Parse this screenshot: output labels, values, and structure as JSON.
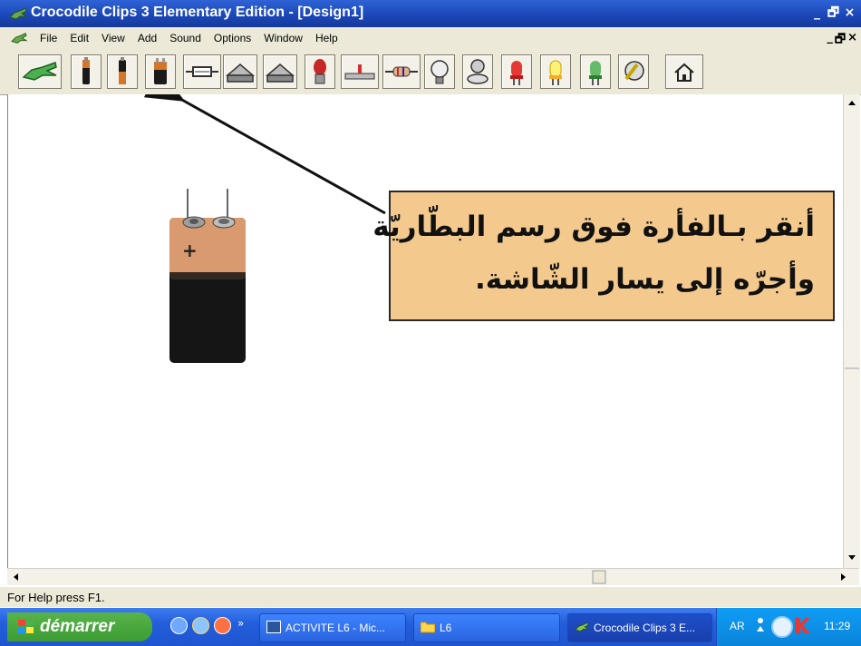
{
  "titlebar": {
    "title": "Crocodile Clips 3 Elementary Edition - [Design1]",
    "buttons": [
      "_",
      "🗗",
      "×"
    ]
  },
  "menubar": {
    "items": [
      "File",
      "Edit",
      "View",
      "Add",
      "Sound",
      "Options",
      "Window",
      "Help"
    ],
    "mdi_buttons": [
      "_",
      "🗗",
      "×"
    ]
  },
  "toolbar": {
    "tools": [
      "crocodile-icon",
      "cell-battery-icon",
      "cell-battery-icon",
      "9v-battery-icon",
      "fuse-icon",
      "switch-icon",
      "switch-icon",
      "bulb-icon",
      "push-switch-icon",
      "resistor-icon",
      "lamp-icon",
      "buzzer-icon",
      "red-led-icon",
      "yellow-led-icon",
      "green-led-icon",
      "motor-icon",
      "home-icon"
    ]
  },
  "canvas": {
    "component": "9v-battery",
    "battery_sign": "+"
  },
  "callout": {
    "line1": "أنقر بـالفأرة فوق رسم البطّاريّة",
    "line2": "وأجرّه إلى يسار الشّاشة."
  },
  "statusbar": {
    "text": "For Help press F1."
  },
  "taskbar": {
    "start_label": "démarrer",
    "tasks": [
      {
        "label": "ACTIVITE L6 - Mic...",
        "icon": "word-icon"
      },
      {
        "label": "L6",
        "icon": "folder-icon"
      },
      {
        "label": "Crocodile Clips 3 E...",
        "icon": "crocodile-icon"
      }
    ],
    "chevron": "»",
    "language": "AR",
    "clock": "11:29"
  },
  "colors": {
    "titlebar": "#1b47b8",
    "callout": "#f4c98d",
    "start": "#3c9b33",
    "taskbar": "#245edb"
  }
}
